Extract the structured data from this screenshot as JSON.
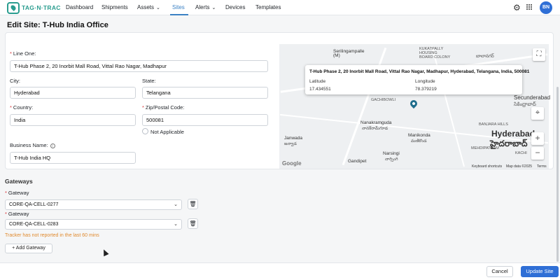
{
  "app": {
    "logo_text": "TAG·N·TRAC",
    "user_initials": "BN"
  },
  "nav": {
    "items": [
      {
        "label": "Dashboard"
      },
      {
        "label": "Shipments"
      },
      {
        "label": "Assets"
      },
      {
        "label": "Sites"
      },
      {
        "label": "Alerts"
      },
      {
        "label": "Devices"
      },
      {
        "label": "Templates"
      }
    ],
    "active": "Sites"
  },
  "page": {
    "title": "Edit Site: T-Hub India Office"
  },
  "form": {
    "line_one": {
      "label": "Line One:",
      "value": "T-Hub Phase 2, 20 Inorbit Mall Road, Vittal Rao Nagar, Madhapur"
    },
    "city": {
      "label": "City:",
      "value": "Hyderabad"
    },
    "state": {
      "label": "State:",
      "value": "Telangana"
    },
    "country": {
      "label": "Country:",
      "value": "India"
    },
    "zip": {
      "label": "Zip/Postal Code:",
      "value": "500081"
    },
    "not_applicable": "Not Applicable",
    "business_name": {
      "label": "Business Name:",
      "value": "T-Hub India HQ"
    }
  },
  "map": {
    "popup": {
      "address": "T-Hub Phase 2, 20 Inorbit Mall Road, Vittal Rao Nagar, Madhapur, Hyderabad, Telangana, India, 500081",
      "latitude_label": "Latitude",
      "latitude": "17.434551",
      "longitude_label": "Longitude",
      "longitude": "78.379219"
    },
    "labels": {
      "serilingampalle": "Serilingampalle\n(M)",
      "kukatpally": "KUKATPALLY\nHOUSING\nBOARD COLONY",
      "gachibowli": "GACHIBOWLI",
      "nanakramguda": "Nanakramguda",
      "nanakramguda_te": "నానక్‌రామ్‌గూడ",
      "manikonda": "Manikonda",
      "manikonda_te": "మణికొండ",
      "janwada": "Janwada",
      "janwada_te": "జన్వాడ",
      "narsingi": "Narsingi",
      "narsingi_te": "నార్సింగి",
      "gandipet": "Gandipet",
      "secunderabad": "Secunderabad",
      "secunderabad_te": "సికింద్రాబాద్",
      "hyderabad": "Hyderabad",
      "hyderabad_te": "హైదరాబాద్",
      "banjara": "BANJARA HILLS",
      "mehdipatnam": "MEHDIPATNAM",
      "kachi": "KACHI",
      "balanagar_te": "బాలానగర్"
    },
    "footer": {
      "shortcuts": "Keyboard shortcuts",
      "data": "Map data ©2025",
      "terms": "Terms"
    },
    "google": "Google"
  },
  "gateways": {
    "title": "Gateways",
    "label": "Gateway",
    "items": [
      {
        "value": "CORE-QA-CELL-0277"
      },
      {
        "value": "CORE-QA-CELL-0283"
      }
    ],
    "warning": "Tracker has not reported in the last 60 mins",
    "add_label": "+ Add Gateway"
  },
  "footer": {
    "cancel": "Cancel",
    "update": "Update Site"
  },
  "colors": {
    "accent": "#2f6fd6",
    "brand": "#2a9d8f",
    "warning": "#e08a2e",
    "required": "#d9383a"
  }
}
